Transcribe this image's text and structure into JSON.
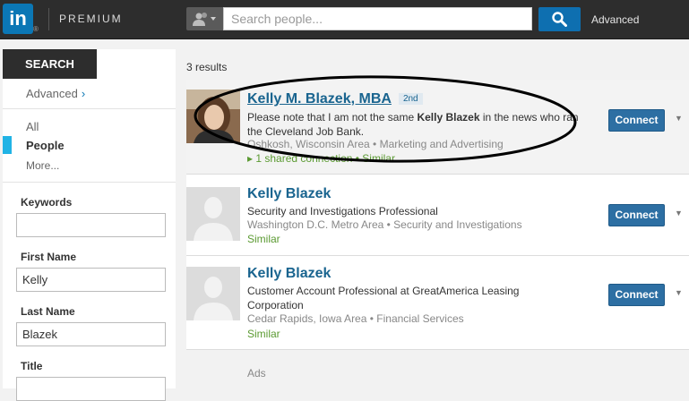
{
  "header": {
    "logo_text": "in",
    "logo_reg": "®",
    "premium_label": "PREMIUM",
    "search_placeholder": "Search people...",
    "advanced_label": "Advanced",
    "brand_color": "#0b77b5"
  },
  "sidebar": {
    "search_tab": "SEARCH",
    "advanced_link": "Advanced",
    "advanced_chevron": "›",
    "facets": {
      "all": "All",
      "people": "People",
      "more": "More..."
    },
    "fields": [
      {
        "label": "Keywords",
        "value": ""
      },
      {
        "label": "First Name",
        "value": "Kelly"
      },
      {
        "label": "Last Name",
        "value": "Blazek"
      },
      {
        "label": "Title",
        "value": ""
      }
    ]
  },
  "results": {
    "count_text": "3 results",
    "items": [
      {
        "name": "Kelly M. Blazek, MBA",
        "degree": "2nd",
        "headline_pre": "Please note that I am not the same ",
        "headline_bold": "Kelly Blazek",
        "headline_post": " in the news who ran the Cleveland Job Bank.",
        "location": "Oshkosh, Wisconsin Area • Marketing and Advertising",
        "extra": "▸ 1 shared connection • Similar",
        "connect": "Connect",
        "caret": "▼"
      },
      {
        "name": "Kelly Blazek",
        "headline": "Security and Investigations Professional",
        "location": "Washington D.C. Metro Area • Security and Investigations",
        "similar": "Similar",
        "connect": "Connect",
        "caret": "▼"
      },
      {
        "name": "Kelly Blazek",
        "headline": "Customer Account Professional at GreatAmerica Leasing Corporation",
        "location": "Cedar Rapids, Iowa Area • Financial Services",
        "similar": "Similar",
        "connect": "Connect",
        "caret": "▼"
      }
    ],
    "ads_label": "Ads"
  }
}
